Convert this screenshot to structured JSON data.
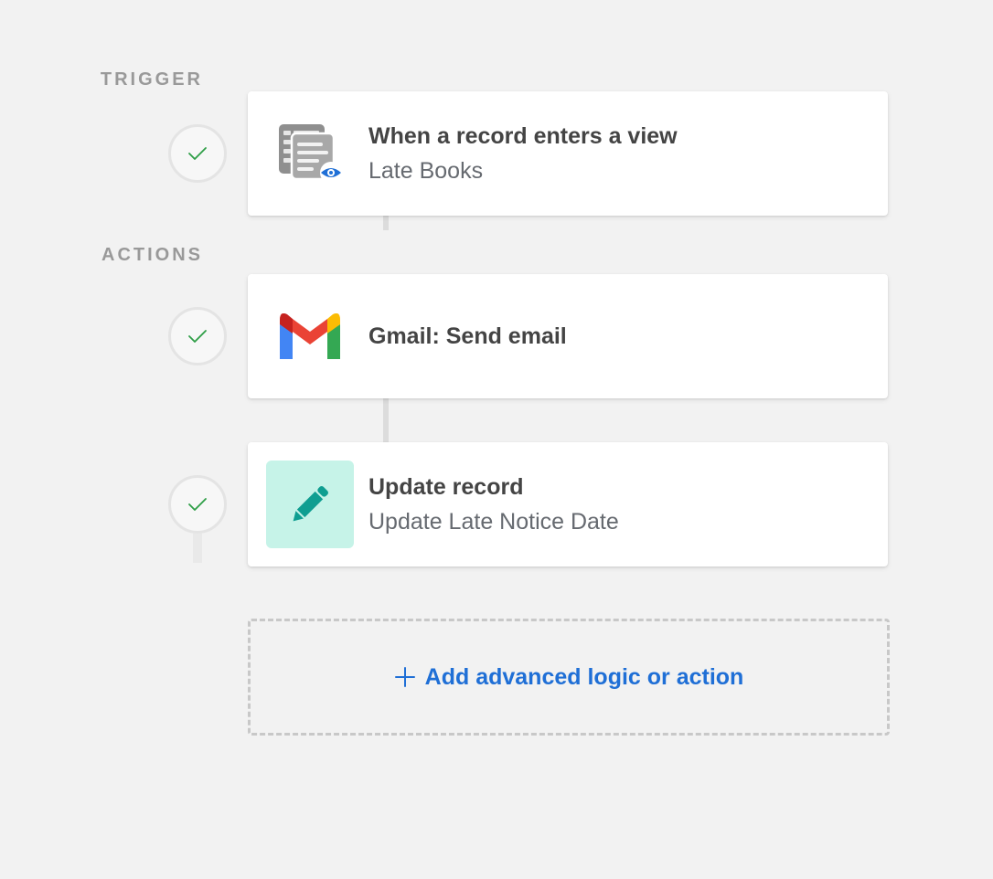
{
  "sections": {
    "trigger_label": "TRIGGER",
    "actions_label": "ACTIONS"
  },
  "steps": [
    {
      "title": "When a record enters a view",
      "subtitle": "Late Books",
      "icon": "record-view-icon",
      "status": "complete"
    },
    {
      "title": "Gmail: Send email",
      "subtitle": "",
      "icon": "gmail-icon",
      "status": "complete"
    },
    {
      "title": "Update record",
      "subtitle": "Update Late Notice Date",
      "icon": "pencil-icon",
      "status": "complete"
    }
  ],
  "add_action": {
    "label": "Add advanced logic or action",
    "icon": "plus-icon"
  },
  "colors": {
    "background": "#f2f2f2",
    "check": "#2e9e46",
    "link_blue": "#1f6fd6",
    "update_icon_bg": "#c6f3e8",
    "update_icon_fg": "#0f9e91"
  }
}
